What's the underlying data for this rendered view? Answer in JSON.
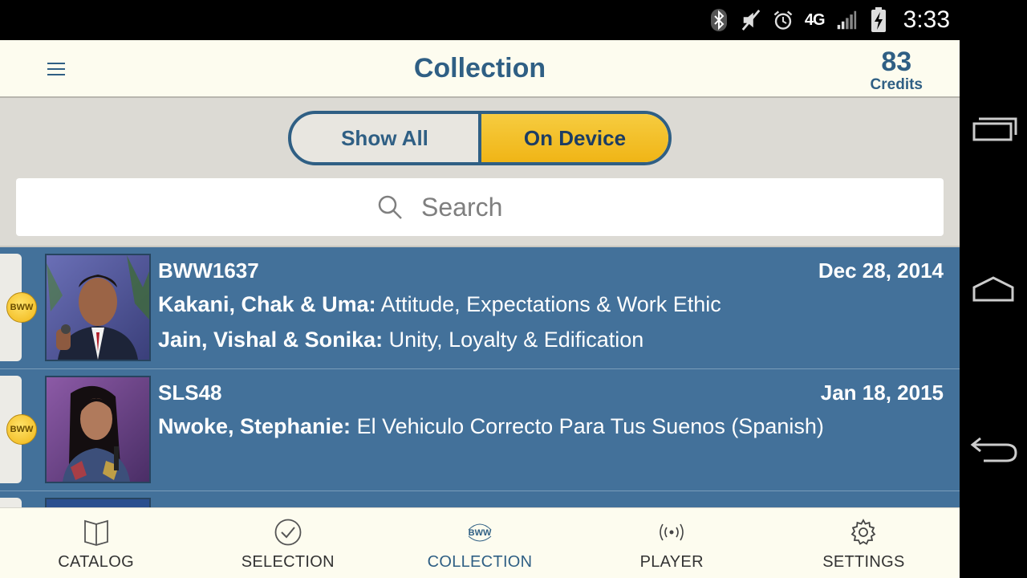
{
  "status_bar": {
    "time": "3:33",
    "network": "4G",
    "icons": [
      "bluetooth-icon",
      "mute-icon",
      "alarm-icon",
      "signal-icon",
      "battery-charging-icon"
    ]
  },
  "header": {
    "title": "Collection",
    "credits_count": "83",
    "credits_label": "Credits"
  },
  "toggle": {
    "options": [
      "Show All",
      "On Device"
    ],
    "selected": "On Device"
  },
  "search": {
    "placeholder": "Search"
  },
  "items": [
    {
      "code": "BWW1637",
      "date": "Dec 28, 2014",
      "badge": "BWW",
      "lines": [
        {
          "speaker": "Kakani, Chak & Uma:",
          "title": "Attitude, Expectations & Work Ethic"
        },
        {
          "speaker": "Jain, Vishal & Sonika:",
          "title": "Unity, Loyalty & Edification"
        }
      ]
    },
    {
      "code": "SLS48",
      "date": "Jan 18, 2015",
      "badge": "BWW",
      "lines": [
        {
          "speaker": "Nwoke, Stephanie:",
          "title": "El Vehiculo Correcto Para Tus Suenos (Spanish)"
        }
      ]
    }
  ],
  "bottom_nav": [
    {
      "label": "CATALOG",
      "icon": "book-icon"
    },
    {
      "label": "SELECTION",
      "icon": "checkmark-circle-icon"
    },
    {
      "label": "COLLECTION",
      "icon": "bww-logo-icon",
      "active": true
    },
    {
      "label": "PLAYER",
      "icon": "broadcast-icon"
    },
    {
      "label": "SETTINGS",
      "icon": "gear-icon"
    }
  ],
  "colors": {
    "brand_blue": "#2f5f84",
    "row_blue": "#43719a",
    "accent_yellow": "#f6c531",
    "header_bg": "#fdfcef"
  }
}
